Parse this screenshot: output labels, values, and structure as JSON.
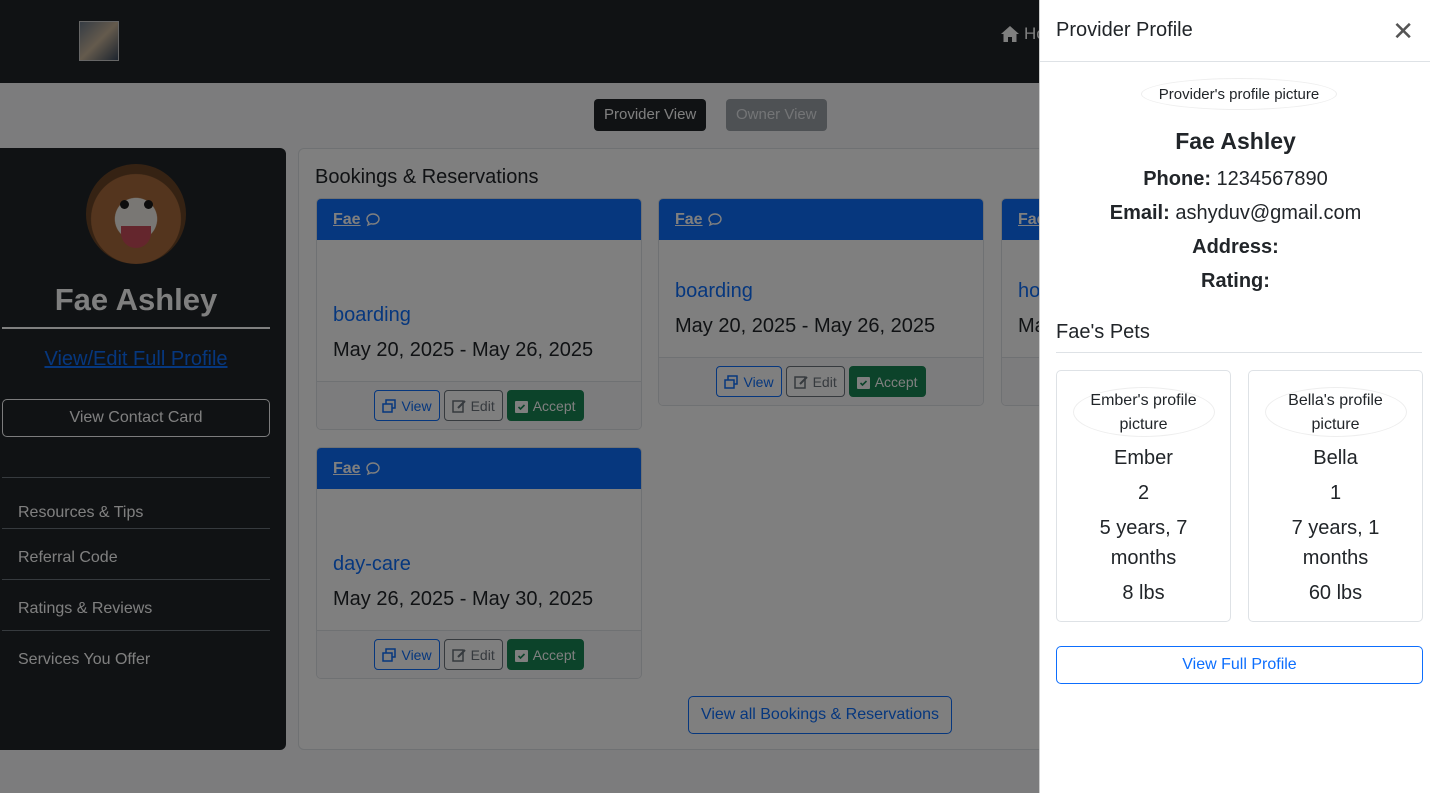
{
  "nav": {
    "home_label": "Ho",
    "logo_alt": "Truly Fetching"
  },
  "view_toggle": {
    "provider": "Provider View",
    "owner": "Owner View"
  },
  "sidebar": {
    "name": "Fae Ashley",
    "edit_link": "View/Edit Full Profile",
    "contact_button": "View Contact Card",
    "menu": [
      "Resources & Tips",
      "Referral Code",
      "Ratings & Reviews",
      "Services You Offer"
    ]
  },
  "bookings": {
    "title": "Bookings & Reservations",
    "cards": [
      {
        "owner": "Fae",
        "service": "boarding",
        "dates": "May 20, 2025 - May 26, 2025"
      },
      {
        "owner": "Fae",
        "service": "boarding",
        "dates": "May 20, 2025 - May 26, 2025"
      },
      {
        "owner": "Fae",
        "service": "ho",
        "dates": "Ma"
      },
      {
        "owner": "Fae",
        "service": "day-care",
        "dates": "May 26, 2025 - May 30, 2025"
      }
    ],
    "buttons": {
      "view": "View",
      "edit": "Edit",
      "accept": "Accept"
    },
    "view_all": "View all Bookings & Reservations"
  },
  "offcanvas": {
    "title": "Provider Profile",
    "close": "✕",
    "picture_alt": "Provider's profile picture",
    "name": "Fae Ashley",
    "phone_label": "Phone:",
    "phone": "1234567890",
    "email_label": "Email:",
    "email": "ashyduv@gmail.com",
    "address_label": "Address:",
    "rating_label": "Rating:",
    "pets_title": "Fae's Pets",
    "pets": [
      {
        "picture_alt": "Ember's profile picture",
        "name": "Ember",
        "id": "2",
        "age": "5 years, 7 months",
        "weight": "8 lbs"
      },
      {
        "picture_alt": "Bella's profile picture",
        "name": "Bella",
        "id": "1",
        "age": "7 years, 1 months",
        "weight": "60 lbs"
      }
    ],
    "full_profile_button": "View Full Profile"
  },
  "colors": {
    "primary": "#0d6efd",
    "success": "#198754",
    "dark": "#212529"
  }
}
